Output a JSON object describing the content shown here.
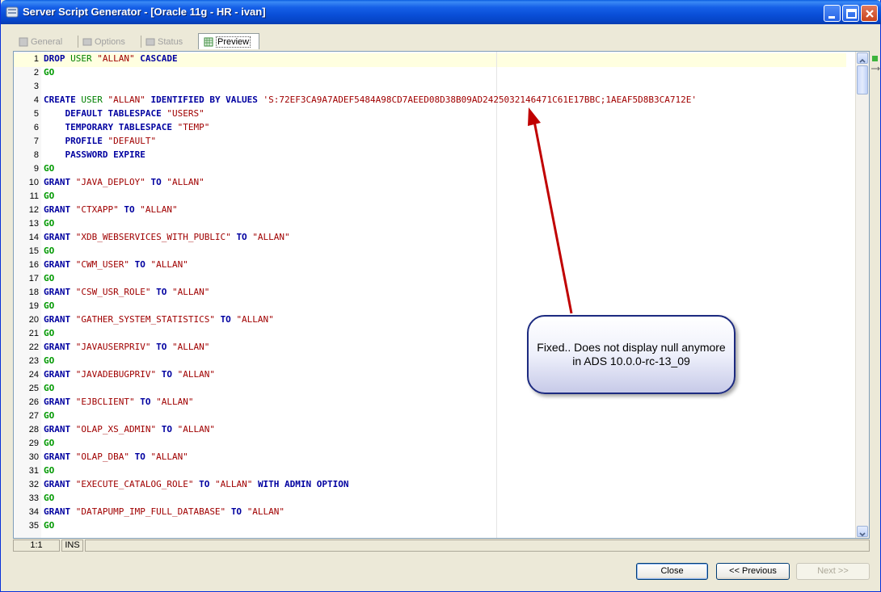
{
  "window": {
    "title": "Server Script Generator - [Oracle 11g - HR - ivan]"
  },
  "tabs": [
    {
      "label": "General",
      "active": false
    },
    {
      "label": "Options",
      "active": false
    },
    {
      "label": "Status",
      "active": false
    },
    {
      "label": "Preview",
      "active": true
    }
  ],
  "editor": {
    "lines": [
      {
        "n": "1",
        "tokens": [
          [
            "kb",
            "DROP "
          ],
          [
            "kg",
            "USER "
          ],
          [
            "st",
            "\"ALLAN\" "
          ],
          [
            "kb",
            "CASCADE"
          ]
        ]
      },
      {
        "n": "2",
        "tokens": [
          [
            "kgo",
            "GO"
          ]
        ]
      },
      {
        "n": "3",
        "tokens": []
      },
      {
        "n": "4",
        "tokens": [
          [
            "kb",
            "CREATE "
          ],
          [
            "kg",
            "USER "
          ],
          [
            "st",
            "\"ALLAN\" "
          ],
          [
            "kb",
            "IDENTIFIED BY VALUES "
          ],
          [
            "st",
            "'S:72EF3CA9A7ADEF5484A98CD7AEED08D38B09AD2425032146471C61E17BBC;1AEAF5D8B3CA712E'"
          ]
        ]
      },
      {
        "n": "5",
        "tokens": [
          [
            "pl",
            "    "
          ],
          [
            "kb",
            "DEFAULT TABLESPACE "
          ],
          [
            "st",
            "\"USERS\""
          ]
        ]
      },
      {
        "n": "6",
        "tokens": [
          [
            "pl",
            "    "
          ],
          [
            "kb",
            "TEMPORARY TABLESPACE "
          ],
          [
            "st",
            "\"TEMP\""
          ]
        ]
      },
      {
        "n": "7",
        "tokens": [
          [
            "pl",
            "    "
          ],
          [
            "kb",
            "PROFILE "
          ],
          [
            "st",
            "\"DEFAULT\""
          ]
        ]
      },
      {
        "n": "8",
        "tokens": [
          [
            "pl",
            "    "
          ],
          [
            "kb",
            "PASSWORD EXPIRE"
          ]
        ]
      },
      {
        "n": "9",
        "tokens": [
          [
            "kgo",
            "GO"
          ]
        ]
      },
      {
        "n": "10",
        "tokens": [
          [
            "kb",
            "GRANT "
          ],
          [
            "st",
            "\"JAVA_DEPLOY\" "
          ],
          [
            "kb",
            "TO "
          ],
          [
            "st",
            "\"ALLAN\""
          ]
        ]
      },
      {
        "n": "11",
        "tokens": [
          [
            "kgo",
            "GO"
          ]
        ]
      },
      {
        "n": "12",
        "tokens": [
          [
            "kb",
            "GRANT "
          ],
          [
            "st",
            "\"CTXAPP\" "
          ],
          [
            "kb",
            "TO "
          ],
          [
            "st",
            "\"ALLAN\""
          ]
        ]
      },
      {
        "n": "13",
        "tokens": [
          [
            "kgo",
            "GO"
          ]
        ]
      },
      {
        "n": "14",
        "tokens": [
          [
            "kb",
            "GRANT "
          ],
          [
            "st",
            "\"XDB_WEBSERVICES_WITH_PUBLIC\" "
          ],
          [
            "kb",
            "TO "
          ],
          [
            "st",
            "\"ALLAN\""
          ]
        ]
      },
      {
        "n": "15",
        "tokens": [
          [
            "kgo",
            "GO"
          ]
        ]
      },
      {
        "n": "16",
        "tokens": [
          [
            "kb",
            "GRANT "
          ],
          [
            "st",
            "\"CWM_USER\" "
          ],
          [
            "kb",
            "TO "
          ],
          [
            "st",
            "\"ALLAN\""
          ]
        ]
      },
      {
        "n": "17",
        "tokens": [
          [
            "kgo",
            "GO"
          ]
        ]
      },
      {
        "n": "18",
        "tokens": [
          [
            "kb",
            "GRANT "
          ],
          [
            "st",
            "\"CSW_USR_ROLE\" "
          ],
          [
            "kb",
            "TO "
          ],
          [
            "st",
            "\"ALLAN\""
          ]
        ]
      },
      {
        "n": "19",
        "tokens": [
          [
            "kgo",
            "GO"
          ]
        ]
      },
      {
        "n": "20",
        "tokens": [
          [
            "kb",
            "GRANT "
          ],
          [
            "st",
            "\"GATHER_SYSTEM_STATISTICS\" "
          ],
          [
            "kb",
            "TO "
          ],
          [
            "st",
            "\"ALLAN\""
          ]
        ]
      },
      {
        "n": "21",
        "tokens": [
          [
            "kgo",
            "GO"
          ]
        ]
      },
      {
        "n": "22",
        "tokens": [
          [
            "kb",
            "GRANT "
          ],
          [
            "st",
            "\"JAVAUSERPRIV\" "
          ],
          [
            "kb",
            "TO "
          ],
          [
            "st",
            "\"ALLAN\""
          ]
        ]
      },
      {
        "n": "23",
        "tokens": [
          [
            "kgo",
            "GO"
          ]
        ]
      },
      {
        "n": "24",
        "tokens": [
          [
            "kb",
            "GRANT "
          ],
          [
            "st",
            "\"JAVADEBUGPRIV\" "
          ],
          [
            "kb",
            "TO "
          ],
          [
            "st",
            "\"ALLAN\""
          ]
        ]
      },
      {
        "n": "25",
        "tokens": [
          [
            "kgo",
            "GO"
          ]
        ]
      },
      {
        "n": "26",
        "tokens": [
          [
            "kb",
            "GRANT "
          ],
          [
            "st",
            "\"EJBCLIENT\" "
          ],
          [
            "kb",
            "TO "
          ],
          [
            "st",
            "\"ALLAN\""
          ]
        ]
      },
      {
        "n": "27",
        "tokens": [
          [
            "kgo",
            "GO"
          ]
        ]
      },
      {
        "n": "28",
        "tokens": [
          [
            "kb",
            "GRANT "
          ],
          [
            "st",
            "\"OLAP_XS_ADMIN\" "
          ],
          [
            "kb",
            "TO "
          ],
          [
            "st",
            "\"ALLAN\""
          ]
        ]
      },
      {
        "n": "29",
        "tokens": [
          [
            "kgo",
            "GO"
          ]
        ]
      },
      {
        "n": "30",
        "tokens": [
          [
            "kb",
            "GRANT "
          ],
          [
            "st",
            "\"OLAP_DBA\" "
          ],
          [
            "kb",
            "TO "
          ],
          [
            "st",
            "\"ALLAN\""
          ]
        ]
      },
      {
        "n": "31",
        "tokens": [
          [
            "kgo",
            "GO"
          ]
        ]
      },
      {
        "n": "32",
        "tokens": [
          [
            "kb",
            "GRANT "
          ],
          [
            "st",
            "\"EXECUTE_CATALOG_ROLE\" "
          ],
          [
            "kb",
            "TO "
          ],
          [
            "st",
            "\"ALLAN\" "
          ],
          [
            "kb",
            "WITH ADMIN OPTION"
          ]
        ]
      },
      {
        "n": "33",
        "tokens": [
          [
            "kgo",
            "GO"
          ]
        ]
      },
      {
        "n": "34",
        "tokens": [
          [
            "kb",
            "GRANT "
          ],
          [
            "st",
            "\"DATAPUMP_IMP_FULL_DATABASE\" "
          ],
          [
            "kb",
            "TO "
          ],
          [
            "st",
            "\"ALLAN\""
          ]
        ]
      },
      {
        "n": "35",
        "tokens": [
          [
            "kgo",
            "GO"
          ]
        ]
      }
    ]
  },
  "statusbar": {
    "position": "1:1",
    "mode": "INS"
  },
  "buttons": {
    "close": "Close",
    "previous": "<< Previous",
    "next": "Next >>"
  },
  "annotation": {
    "text": "Fixed.. Does not display null anymore in ADS 10.0.0-rc-13_09"
  },
  "colors": {
    "keyword": "#0000a0",
    "string": "#a00000",
    "go": "#009900",
    "user": "#008000",
    "title_bar": "#0a4fd8"
  }
}
